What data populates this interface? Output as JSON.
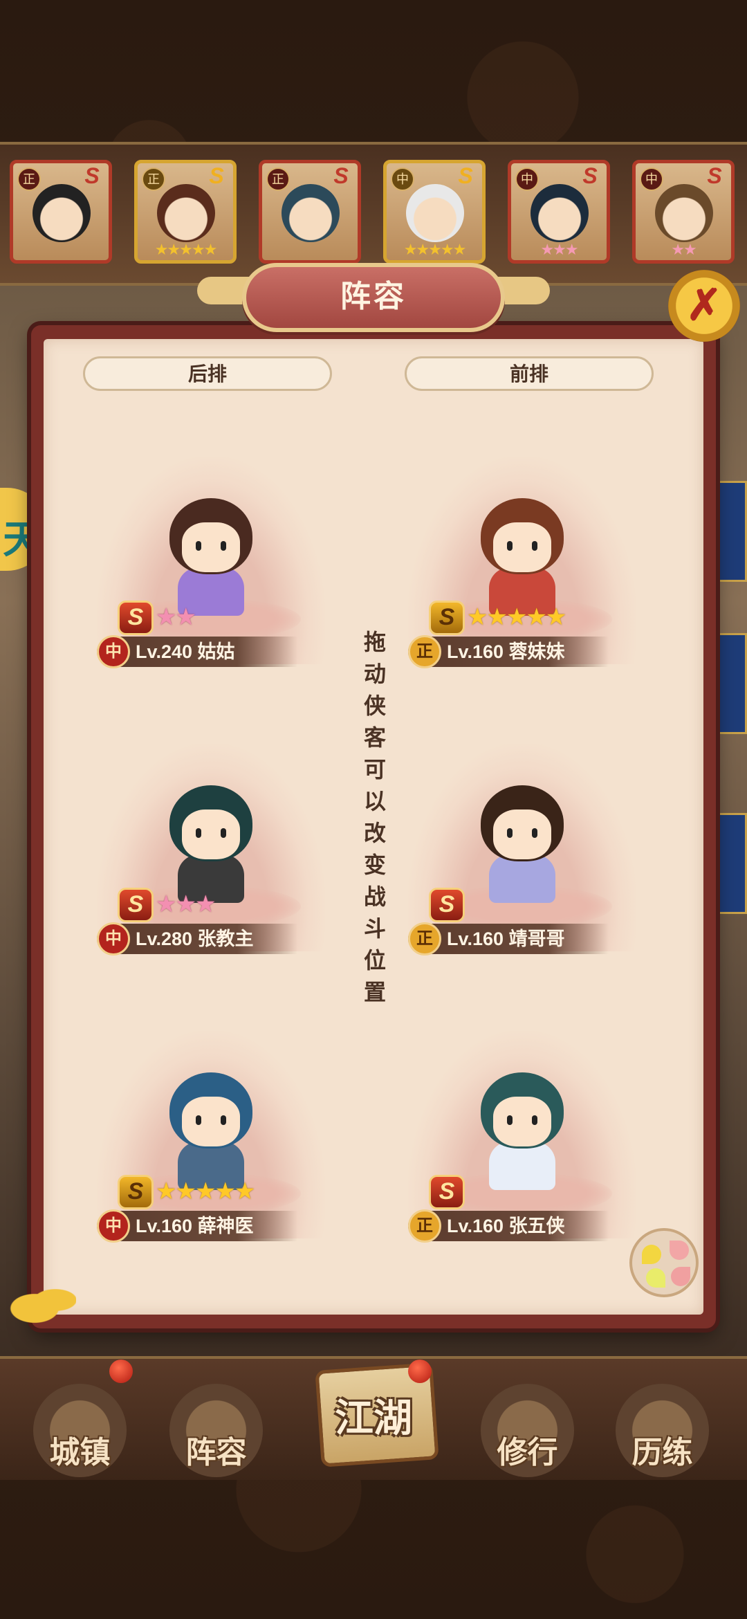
{
  "panel": {
    "title": "阵容",
    "close_label": "✗"
  },
  "rows": {
    "back_label": "后排",
    "front_label": "前排"
  },
  "hint": "拖动侠客可以改变战斗位置",
  "roster": [
    {
      "faction": "正",
      "grade": "S",
      "stars": "",
      "star_color": "gold",
      "hair": "#222222"
    },
    {
      "faction": "正",
      "grade": "S",
      "stars": "★★★★★",
      "star_color": "gold",
      "hair": "#5a2c1c"
    },
    {
      "faction": "正",
      "grade": "S",
      "stars": "",
      "star_color": "gold",
      "hair": "#2c4a5a"
    },
    {
      "faction": "中",
      "grade": "S",
      "stars": "★★★★★",
      "star_color": "gold",
      "hair": "#e8e8e8"
    },
    {
      "faction": "中",
      "grade": "S",
      "stars": "★★★",
      "star_color": "pink",
      "hair": "#1c2c3c"
    },
    {
      "faction": "中",
      "grade": "S",
      "stars": "★★",
      "star_color": "pink",
      "hair": "#6a4a2a"
    }
  ],
  "lineup": [
    {
      "slot": "back-1",
      "faction": "中",
      "grade": "S",
      "stars": "★★",
      "star_color": "pink",
      "level_name": "Lv.240 姑姑",
      "hair": "#4a2a20",
      "outfit": "#9b7bd6"
    },
    {
      "slot": "front-1",
      "faction": "正",
      "grade": "S",
      "stars": "★★★★★",
      "star_color": "gold",
      "level_name": "Lv.160 蓉妹妹",
      "hair": "#7a3a22",
      "outfit": "#c9483a"
    },
    {
      "slot": "back-2",
      "faction": "中",
      "grade": "S",
      "stars": "★★★",
      "star_color": "pink",
      "level_name": "Lv.280 张教主",
      "hair": "#1e4040",
      "outfit": "#3a3a3a"
    },
    {
      "slot": "front-2",
      "faction": "正",
      "grade": "S",
      "stars": "",
      "star_color": "gold",
      "level_name": "Lv.160 靖哥哥",
      "hair": "#3a2418",
      "outfit": "#a7a7e0"
    },
    {
      "slot": "back-3",
      "faction": "中",
      "grade": "S",
      "stars": "★★★★★",
      "star_color": "gold",
      "level_name": "Lv.160 薛神医",
      "hair": "#2b5f86",
      "outfit": "#4a6a8a"
    },
    {
      "slot": "front-3",
      "faction": "正",
      "grade": "S",
      "stars": "",
      "star_color": "gold",
      "level_name": "Lv.160 张五侠",
      "hair": "#2a5a5a",
      "outfit": "#e8eef8"
    }
  ],
  "nav": [
    {
      "id": "town",
      "label": "城镇"
    },
    {
      "id": "lineup",
      "label": "阵容"
    },
    {
      "id": "jianghu",
      "label": "江湖"
    },
    {
      "id": "training",
      "label": "修行"
    },
    {
      "id": "trial",
      "label": "历练"
    }
  ],
  "side_glyph": "天",
  "colors": {
    "panel_border": "#7a2f28",
    "panel_bg": "#f4e2cf",
    "accent_gold": "#f2c33b",
    "faction_zhong": "#b3241d",
    "faction_zheng": "#e6a62b"
  }
}
